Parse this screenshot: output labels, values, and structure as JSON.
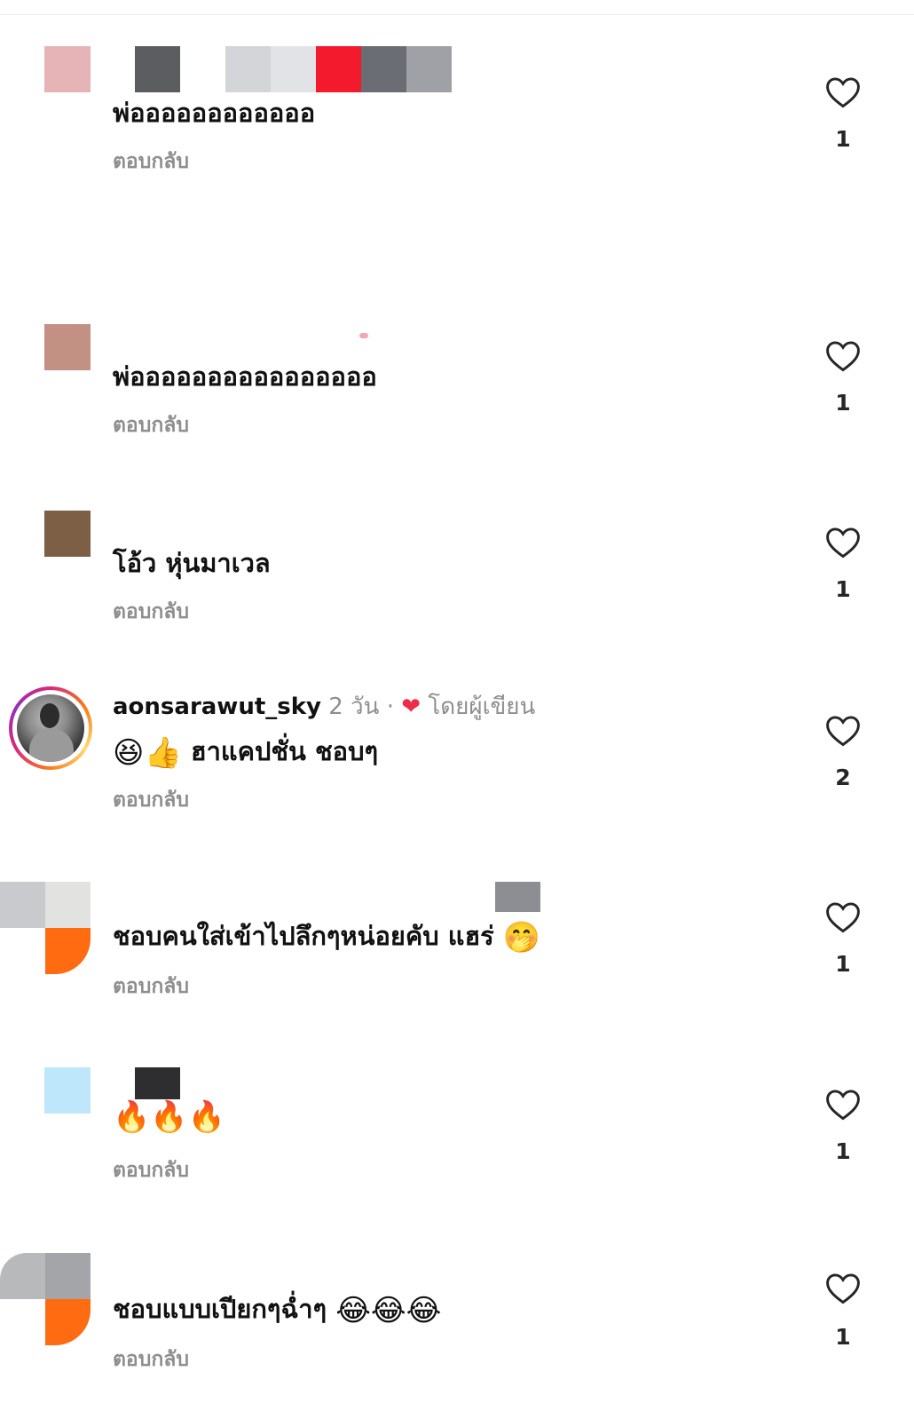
{
  "reply_label": "ตอบกลับ",
  "comments": [
    {
      "text": "พ่ออออออออออออ",
      "likes": "1"
    },
    {
      "text": "พ่ออออออออออออออออ",
      "likes": "1"
    },
    {
      "text": "โอ้ว หุ่นมาเวล",
      "likes": "1"
    },
    {
      "username": "aonsarawut_sky",
      "time": "2 วัน",
      "separator": "·",
      "heart": "❤",
      "by_author": "โดยผู้เขียน",
      "emoji_prefix": "😆👍",
      "text": "ฮาแคปชั่น ชอบๆ",
      "likes": "2"
    },
    {
      "text": "ชอบคนใส่เข้าไปลึกๆหน่อยคับ แฮร่",
      "emoji_suffix": "🤭",
      "likes": "1"
    },
    {
      "emoji_text": "🔥🔥🔥",
      "likes": "1"
    },
    {
      "text": "ชอบแบบเปียกๆฉ่ำๆ",
      "emoji_suffix": "😂😂😂",
      "likes": "1"
    }
  ],
  "icons": {
    "like": "heart-outline-icon"
  },
  "colors": {
    "heart_red": "#ed2e48",
    "muted": "#8e8e8e"
  }
}
